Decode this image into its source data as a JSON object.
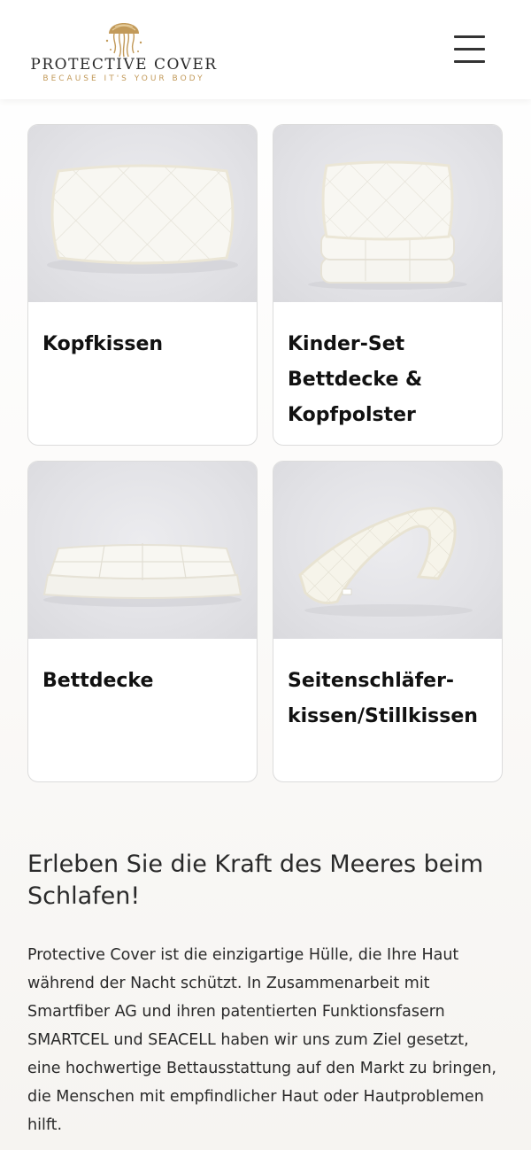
{
  "header": {
    "logo_title": "PROTECTIVE COVER",
    "logo_tagline": "BECAUSE IT'S YOUR BODY",
    "menu_icon": "hamburger-menu-icon",
    "brand_color": "#c29a5a"
  },
  "products": [
    {
      "title": "Kopfkissen",
      "image": "pillow"
    },
    {
      "title": "Kinder-Set Bettdecke & Kopfpolster",
      "image": "kids-set"
    },
    {
      "title": "Bettdecke",
      "image": "duvet"
    },
    {
      "title": "Seitenschläfer-kissen/Stillkissen",
      "image": "side-sleeper-pillow"
    }
  ],
  "section": {
    "heading": "Erleben Sie die Kraft des Meeres beim Schlafen!",
    "text": "Protective Cover ist die einzigartige Hülle, die Ihre Haut während der Nacht schützt. In Zusammenarbeit mit Smartfiber AG und ihren patentierten Funktionsfasern SMARTCEL und SEACELL haben wir uns zum Ziel gesetzt, eine hochwertige Bettausstattung auf den Markt zu bringen, die Menschen mit empfindlicher Haut oder Hautproblemen hilft."
  }
}
